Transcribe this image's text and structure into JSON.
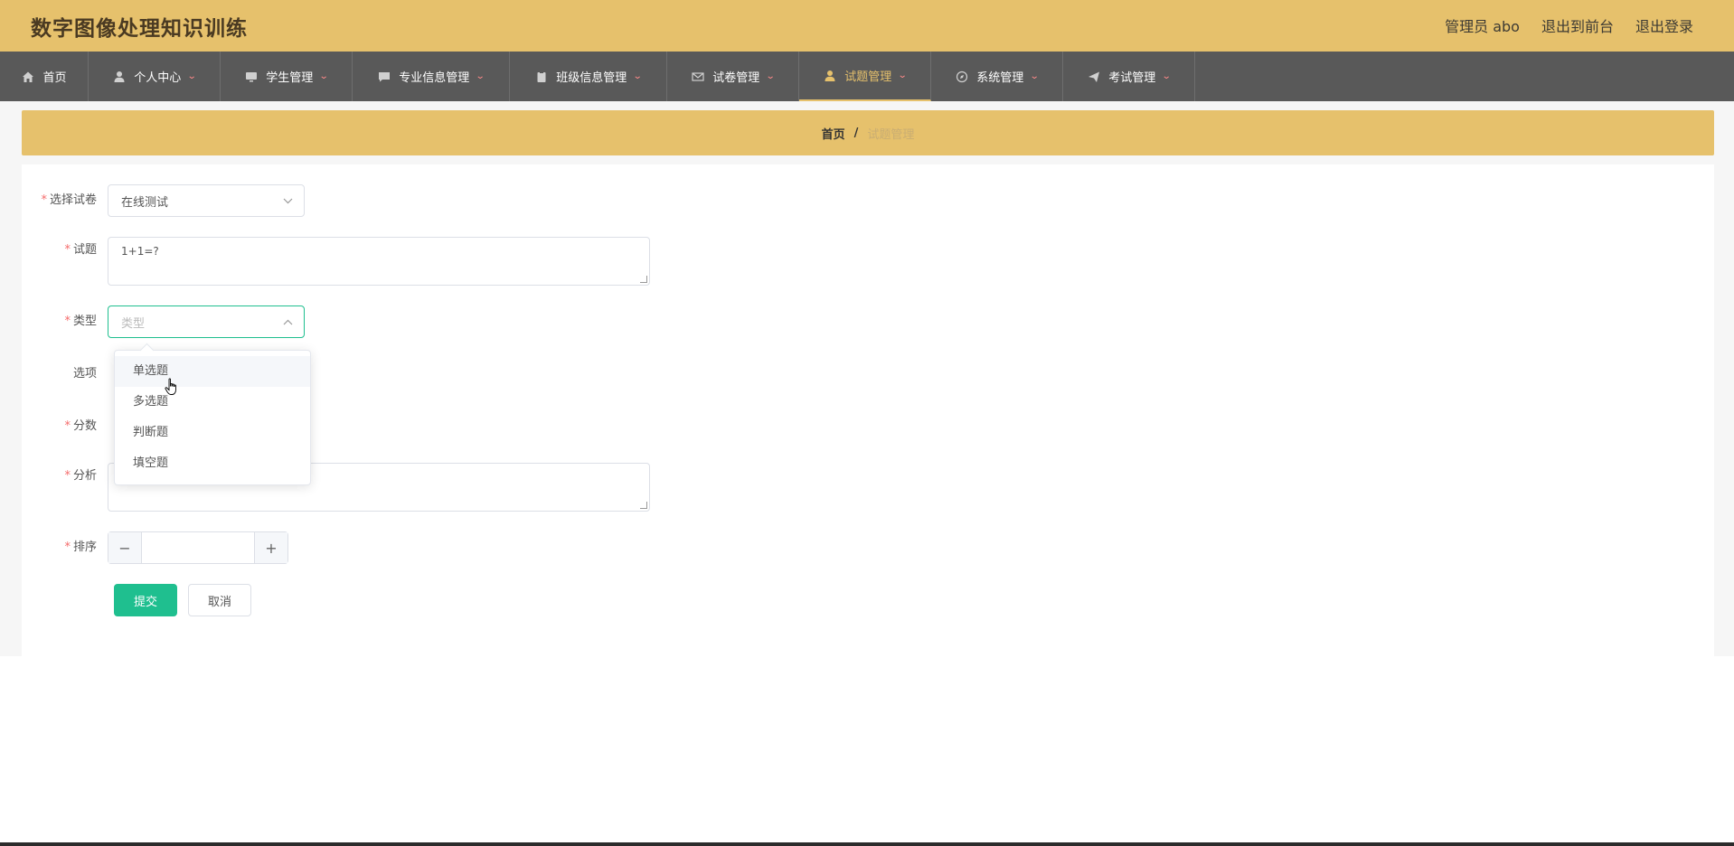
{
  "app": {
    "title": "数字图像处理知识训练"
  },
  "header": {
    "admin_label": "管理员 abo",
    "to_front_label": "退出到前台",
    "logout_label": "退出登录"
  },
  "nav": {
    "items": [
      {
        "label": "首页",
        "icon": "home-icon",
        "has_caret": false
      },
      {
        "label": "个人中心",
        "icon": "user-icon",
        "has_caret": true
      },
      {
        "label": "学生管理",
        "icon": "monitor-icon",
        "has_caret": true
      },
      {
        "label": "专业信息管理",
        "icon": "chat-icon",
        "has_caret": true
      },
      {
        "label": "班级信息管理",
        "icon": "clipboard-icon",
        "has_caret": true
      },
      {
        "label": "试卷管理",
        "icon": "mail-icon",
        "has_caret": true
      },
      {
        "label": "试题管理",
        "icon": "user-icon",
        "has_caret": true,
        "active": true
      },
      {
        "label": "系统管理",
        "icon": "compass-icon",
        "has_caret": true
      },
      {
        "label": "考试管理",
        "icon": "send-icon",
        "has_caret": true
      }
    ]
  },
  "breadcrumb": {
    "home": "首页",
    "separator": "/",
    "current": "试题管理"
  },
  "form": {
    "paper": {
      "label": "选择试卷",
      "value": "在线测试",
      "required": true
    },
    "question": {
      "label": "试题",
      "value": "1+1=?",
      "required": true
    },
    "type": {
      "label": "类型",
      "placeholder": "类型",
      "required": true
    },
    "options": {
      "label": "选项",
      "required": false
    },
    "score": {
      "label": "分数",
      "required": true
    },
    "analysis": {
      "label": "分析",
      "value": "",
      "required": true
    },
    "order": {
      "label": "排序",
      "value": "",
      "required": true
    },
    "submit_label": "提交",
    "cancel_label": "取消"
  },
  "type_dropdown": {
    "options": [
      "单选题",
      "多选题",
      "判断题",
      "填空题"
    ],
    "hovered_index": 0
  },
  "colors": {
    "header_bg": "#e6c16c",
    "nav_bg": "#595959",
    "primary": "#1fbf8f",
    "required": "#f56c6c"
  }
}
